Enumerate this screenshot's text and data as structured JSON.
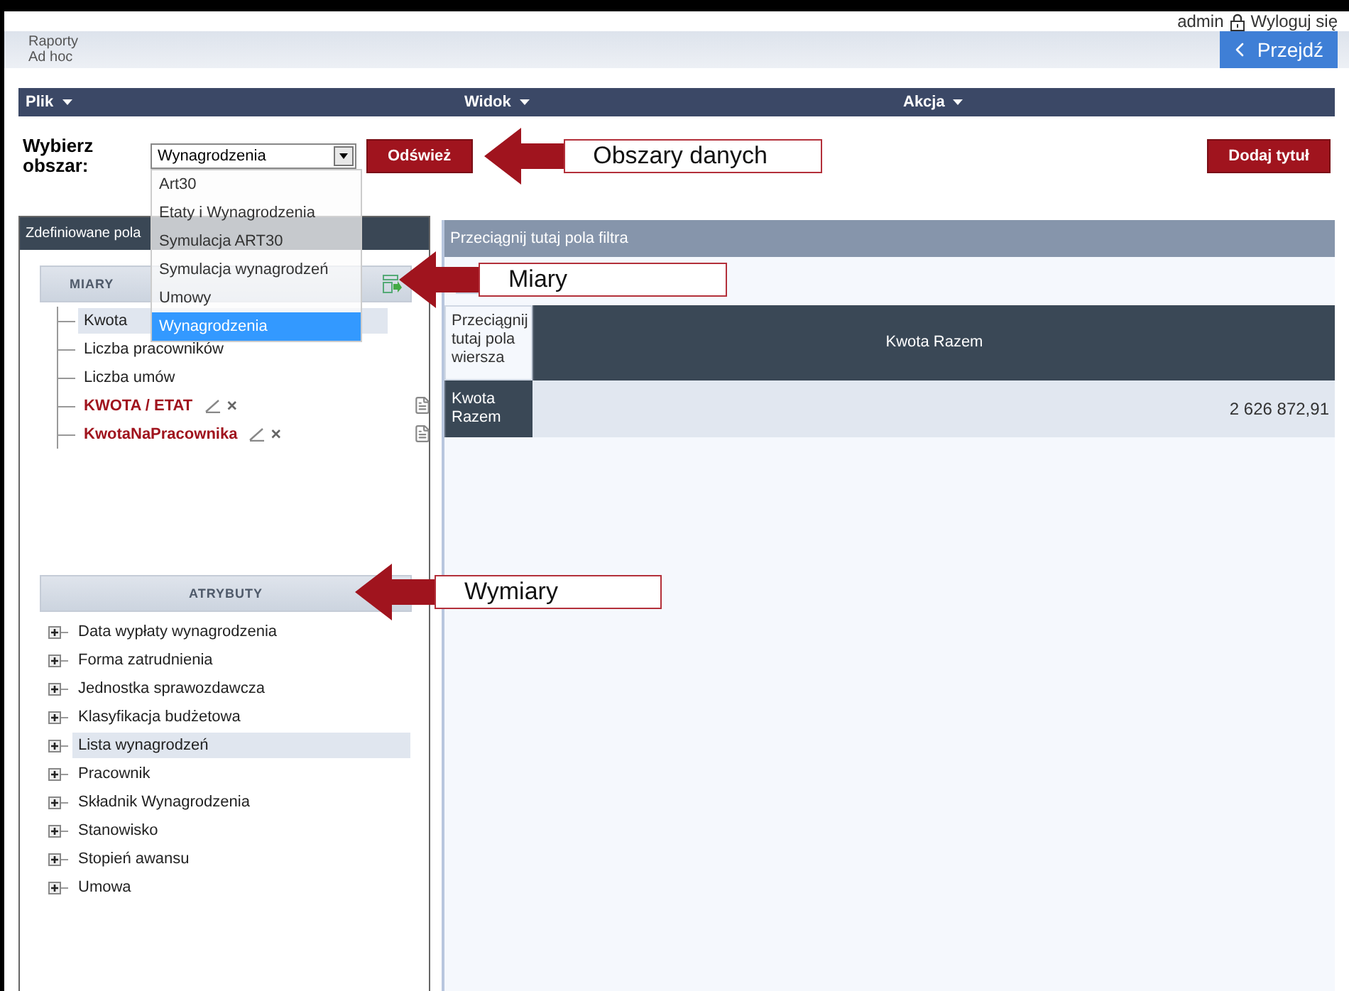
{
  "user": {
    "name": "admin",
    "logout": "Wyloguj się"
  },
  "header": {
    "title_lines": [
      "Raporty",
      "Ad hoc"
    ],
    "go_button": "Przejdź"
  },
  "menu": [
    {
      "label": "Plik"
    },
    {
      "label": "Widok"
    },
    {
      "label": "Akcja"
    }
  ],
  "area_picker": {
    "label": "Wybierz obszar:",
    "value": "Wynagrodzenia",
    "expanded": true,
    "callout": "Obszary danych",
    "options": [
      {
        "label": "Art30",
        "selected": false
      },
      {
        "label": "Etaty i Wynagrodzenia",
        "selected": false
      },
      {
        "label": "Symulacja ART30",
        "selected": false
      },
      {
        "label": "Symulacja wynagrodzeń",
        "selected": false
      },
      {
        "label": "Umowy",
        "selected": false
      },
      {
        "label": "Wynagrodzenia",
        "selected": true
      }
    ]
  },
  "buttons": {
    "refresh": "Odśwież",
    "add_title": "Dodaj tytuł"
  },
  "fields_panel": {
    "title": "Zdefiniowane pola",
    "measures": {
      "heading": "MIARY",
      "callout": "Miary",
      "items": [
        {
          "label": "Kwota",
          "kind": "base",
          "highlighted": true
        },
        {
          "label": "Liczba pracowników",
          "kind": "base",
          "highlighted": false
        },
        {
          "label": "Liczba umów",
          "kind": "base",
          "highlighted": false
        },
        {
          "label": "KWOTA / ETAT",
          "kind": "calculated",
          "highlighted": false
        },
        {
          "label": "KwotaNaPracownika",
          "kind": "calculated",
          "highlighted": false
        }
      ]
    },
    "attributes": {
      "heading": "ATRYBUTY",
      "callout": "Wymiary",
      "items": [
        {
          "label": "Data wypłaty wynagrodzenia",
          "highlighted": false
        },
        {
          "label": "Forma zatrudnienia",
          "highlighted": false
        },
        {
          "label": "Jednostka sprawozdawcza",
          "highlighted": false
        },
        {
          "label": "Klasyfikacja budżetowa",
          "highlighted": false
        },
        {
          "label": "Lista wynagrodzeń",
          "highlighted": true
        },
        {
          "label": "Pracownik",
          "highlighted": false
        },
        {
          "label": "Składnik Wynagrodzenia",
          "highlighted": false
        },
        {
          "label": "Stanowisko",
          "highlighted": false
        },
        {
          "label": "Stopień awansu",
          "highlighted": false
        },
        {
          "label": "Umowa",
          "highlighted": false
        }
      ]
    }
  },
  "pivot": {
    "filter_zone": "Przeciągnij tutaj pola filtra",
    "row_zone": "Przeciągnij tutaj pola wiersza",
    "column_header": "Kwota Razem",
    "row_header": "Kwota Razem",
    "value": "2 626 872,91"
  }
}
